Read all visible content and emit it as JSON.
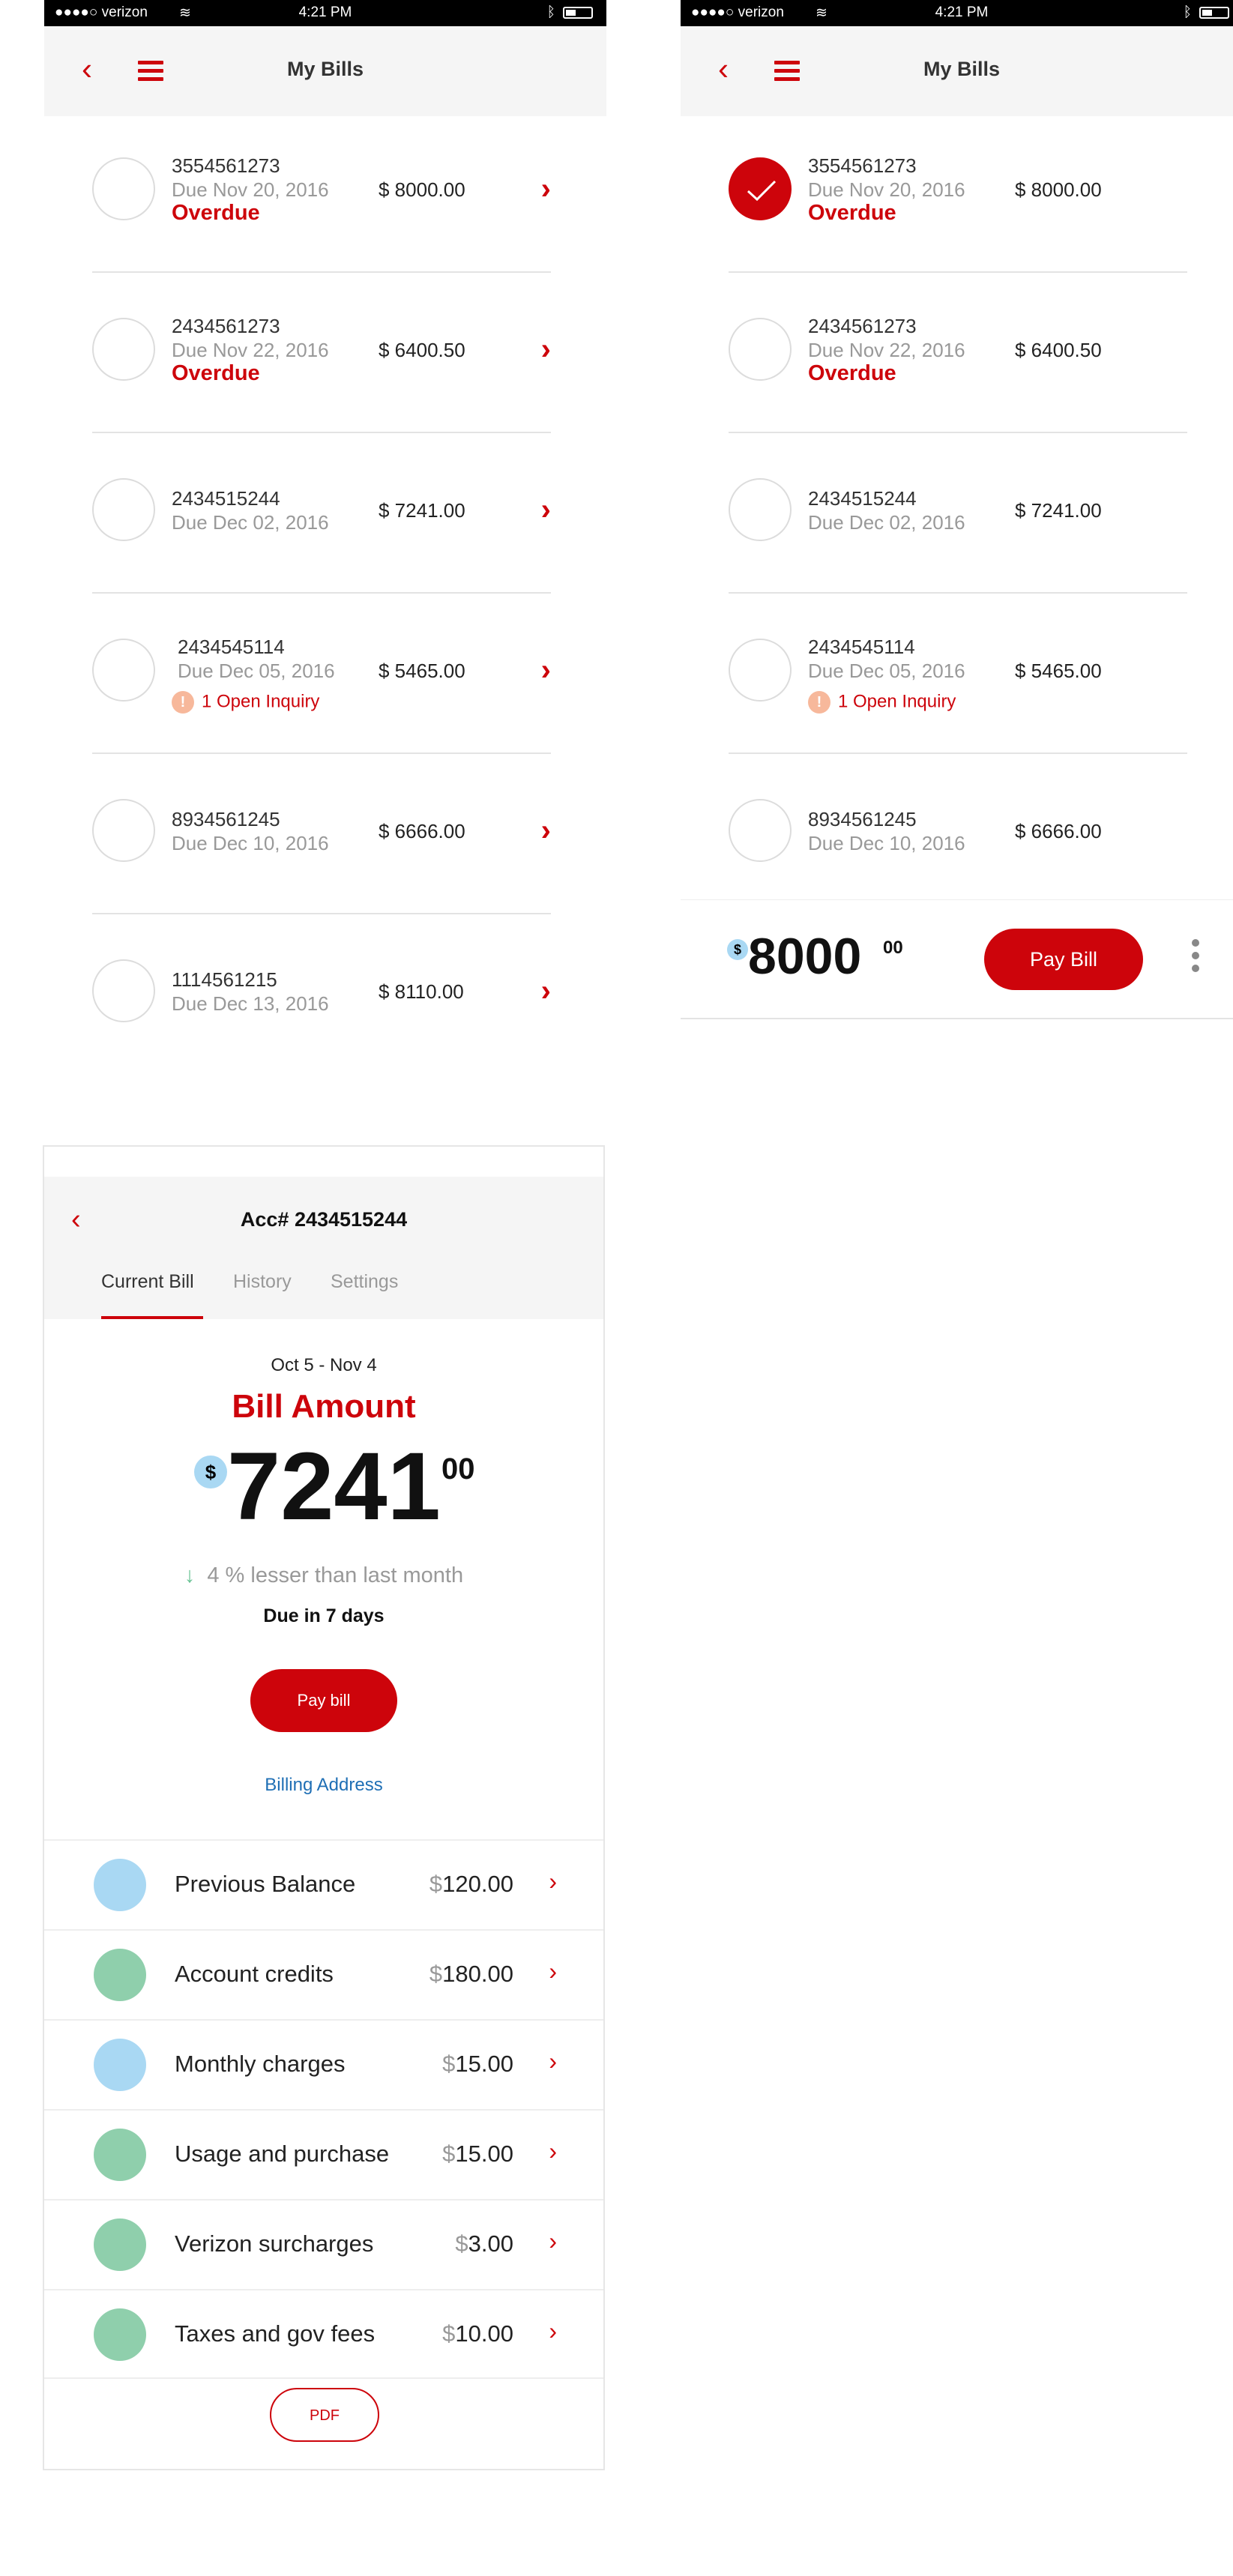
{
  "status_bar": {
    "carrier": "●●●●○ verizon",
    "time": "4:21 PM"
  },
  "my_bills": {
    "title": "My Bills",
    "bills": [
      {
        "account": "3554561273",
        "due": "Due Nov 20, 2016",
        "status": "Overdue",
        "amount": "$ 8000.00"
      },
      {
        "account": "2434561273",
        "due": "Due Nov 22, 2016",
        "status": "Overdue",
        "amount": "$ 6400.50"
      },
      {
        "account": "2434515244",
        "due": "Due Dec 02, 2016",
        "amount": "$ 7241.00"
      },
      {
        "account": "2434545114",
        "due": "Due Dec 05, 2016",
        "inquiry": "1 Open Inquiry",
        "amount": "$ 5465.00"
      },
      {
        "account": "8934561245",
        "due": "Due Dec 10, 2016",
        "amount": "$ 6666.00"
      },
      {
        "account": "1114561215",
        "due": "Due Dec 13, 2016",
        "amount": "$ 8110.00"
      }
    ],
    "selected_total": {
      "currency": "$",
      "whole": "8000",
      "cents": "00"
    },
    "pay_button": "Pay Bill"
  },
  "account_detail": {
    "title": "Acc# 2434515244",
    "tabs": [
      "Current Bill",
      "History",
      "Settings"
    ],
    "period": "Oct 5  -  Nov 4",
    "heading": "Bill Amount",
    "currency": "$",
    "amount_whole": "7241",
    "amount_cents": "00",
    "comparison": "4 % lesser than last month",
    "due_in": "Due in 7 days",
    "pay_button": "Pay bill",
    "billing_address": "Billing Address",
    "charges": [
      {
        "label": "Previous Balance",
        "currency": "$",
        "value": "120.00",
        "color": "#a9d8f3"
      },
      {
        "label": "Account credits",
        "currency": "$",
        "value": "180.00",
        "color": "#8fcfac"
      },
      {
        "label": "Monthly charges",
        "currency": "$",
        "value": "15.00",
        "color": "#a9d8f3"
      },
      {
        "label": "Usage and purchase",
        "currency": "$",
        "value": "15.00",
        "color": "#8fcfac"
      },
      {
        "label": "Verizon surcharges",
        "currency": "$",
        "value": "3.00",
        "color": "#8fcfac"
      },
      {
        "label": "Taxes and gov fees",
        "currency": "$",
        "value": "10.00",
        "color": "#8fcfac"
      }
    ],
    "pdf_button": "PDF"
  },
  "colors": {
    "brand_red": "#cd040b",
    "credit_green": "#8fcfac",
    "balance_blue": "#a9d8f3",
    "link_blue": "#1f6fb5"
  },
  "icons": [
    "back-chevron-icon",
    "hamburger-menu-icon",
    "chevron-right-icon",
    "checkmark-icon",
    "wifi-icon",
    "bluetooth-icon",
    "battery-icon",
    "more-vertical-icon",
    "down-arrow-icon",
    "alert-icon"
  ]
}
